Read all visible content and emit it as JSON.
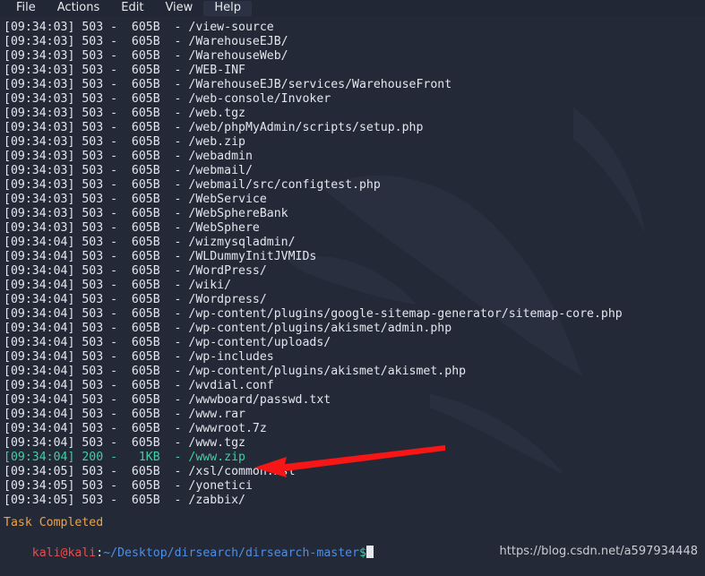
{
  "window": {
    "background_color": "#232936",
    "menubar_background": "#222735",
    "text_color": "#e3e6ec"
  },
  "menubar": {
    "items": [
      {
        "label": "File",
        "highlighted": false
      },
      {
        "label": "Actions",
        "highlighted": false
      },
      {
        "label": "Edit",
        "highlighted": false
      },
      {
        "label": "View",
        "highlighted": false
      },
      {
        "label": "Help",
        "highlighted": true
      }
    ]
  },
  "terminal": {
    "log_lines": [
      {
        "time": "[09:34:03]",
        "status": "503",
        "size": "605B",
        "path": "/view-source",
        "color": "default"
      },
      {
        "time": "[09:34:03]",
        "status": "503",
        "size": "605B",
        "path": "/WarehouseEJB/",
        "color": "default"
      },
      {
        "time": "[09:34:03]",
        "status": "503",
        "size": "605B",
        "path": "/WarehouseWeb/",
        "color": "default"
      },
      {
        "time": "[09:34:03]",
        "status": "503",
        "size": "605B",
        "path": "/WEB-INF",
        "color": "default"
      },
      {
        "time": "[09:34:03]",
        "status": "503",
        "size": "605B",
        "path": "/WarehouseEJB/services/WarehouseFront",
        "color": "default"
      },
      {
        "time": "[09:34:03]",
        "status": "503",
        "size": "605B",
        "path": "/web-console/Invoker",
        "color": "default"
      },
      {
        "time": "[09:34:03]",
        "status": "503",
        "size": "605B",
        "path": "/web.tgz",
        "color": "default"
      },
      {
        "time": "[09:34:03]",
        "status": "503",
        "size": "605B",
        "path": "/web/phpMyAdmin/scripts/setup.php",
        "color": "default"
      },
      {
        "time": "[09:34:03]",
        "status": "503",
        "size": "605B",
        "path": "/web.zip",
        "color": "default"
      },
      {
        "time": "[09:34:03]",
        "status": "503",
        "size": "605B",
        "path": "/webadmin",
        "color": "default"
      },
      {
        "time": "[09:34:03]",
        "status": "503",
        "size": "605B",
        "path": "/webmail/",
        "color": "default"
      },
      {
        "time": "[09:34:03]",
        "status": "503",
        "size": "605B",
        "path": "/webmail/src/configtest.php",
        "color": "default"
      },
      {
        "time": "[09:34:03]",
        "status": "503",
        "size": "605B",
        "path": "/WebService",
        "color": "default"
      },
      {
        "time": "[09:34:03]",
        "status": "503",
        "size": "605B",
        "path": "/WebSphereBank",
        "color": "default"
      },
      {
        "time": "[09:34:03]",
        "status": "503",
        "size": "605B",
        "path": "/WebSphere",
        "color": "default"
      },
      {
        "time": "[09:34:04]",
        "status": "503",
        "size": "605B",
        "path": "/wizmysqladmin/",
        "color": "default"
      },
      {
        "time": "[09:34:04]",
        "status": "503",
        "size": "605B",
        "path": "/WLDummyInitJVMIDs",
        "color": "default"
      },
      {
        "time": "[09:34:04]",
        "status": "503",
        "size": "605B",
        "path": "/WordPress/",
        "color": "default"
      },
      {
        "time": "[09:34:04]",
        "status": "503",
        "size": "605B",
        "path": "/wiki/",
        "color": "default"
      },
      {
        "time": "[09:34:04]",
        "status": "503",
        "size": "605B",
        "path": "/Wordpress/",
        "color": "default"
      },
      {
        "time": "[09:34:04]",
        "status": "503",
        "size": "605B",
        "path": "/wp-content/plugins/google-sitemap-generator/sitemap-core.php",
        "color": "default"
      },
      {
        "time": "[09:34:04]",
        "status": "503",
        "size": "605B",
        "path": "/wp-content/plugins/akismet/admin.php",
        "color": "default"
      },
      {
        "time": "[09:34:04]",
        "status": "503",
        "size": "605B",
        "path": "/wp-content/uploads/",
        "color": "default"
      },
      {
        "time": "[09:34:04]",
        "status": "503",
        "size": "605B",
        "path": "/wp-includes",
        "color": "default"
      },
      {
        "time": "[09:34:04]",
        "status": "503",
        "size": "605B",
        "path": "/wp-content/plugins/akismet/akismet.php",
        "color": "default"
      },
      {
        "time": "[09:34:04]",
        "status": "503",
        "size": "605B",
        "path": "/wvdial.conf",
        "color": "default"
      },
      {
        "time": "[09:34:04]",
        "status": "503",
        "size": "605B",
        "path": "/wwwboard/passwd.txt",
        "color": "default"
      },
      {
        "time": "[09:34:04]",
        "status": "503",
        "size": "605B",
        "path": "/www.rar",
        "color": "default"
      },
      {
        "time": "[09:34:04]",
        "status": "503",
        "size": "605B",
        "path": "/wwwroot.7z",
        "color": "default"
      },
      {
        "time": "[09:34:04]",
        "status": "503",
        "size": "605B",
        "path": "/www.tgz",
        "color": "default"
      },
      {
        "time": "[09:34:04]",
        "status": "200",
        "size": "1KB",
        "path": "/www.zip",
        "color": "green"
      },
      {
        "time": "[09:34:05]",
        "status": "503",
        "size": "605B",
        "path": "/xsl/common.xsl",
        "color": "default"
      },
      {
        "time": "[09:34:05]",
        "status": "503",
        "size": "605B",
        "path": "/yonetici",
        "color": "default"
      },
      {
        "time": "[09:34:05]",
        "status": "503",
        "size": "605B",
        "path": "/zabbix/",
        "color": "default"
      }
    ],
    "status_message": "Task Completed",
    "prompt": {
      "user_host": "kali@kali",
      "separator": ":",
      "path": "~/Desktop/dirsearch/dirsearch-master",
      "symbol": "$",
      "command": ""
    }
  },
  "annotation": {
    "arrow_color": "#f71616",
    "arrow_points_to": "/www.zip"
  },
  "watermark": {
    "text": "https://blog.csdn.net/a597934448"
  },
  "colors": {
    "success_green": "#3fd0a3",
    "status_orange": "#eda34a",
    "prompt_red": "#ef4b4b",
    "prompt_blue": "#4e8fe6",
    "arrow_red": "#f71616"
  }
}
